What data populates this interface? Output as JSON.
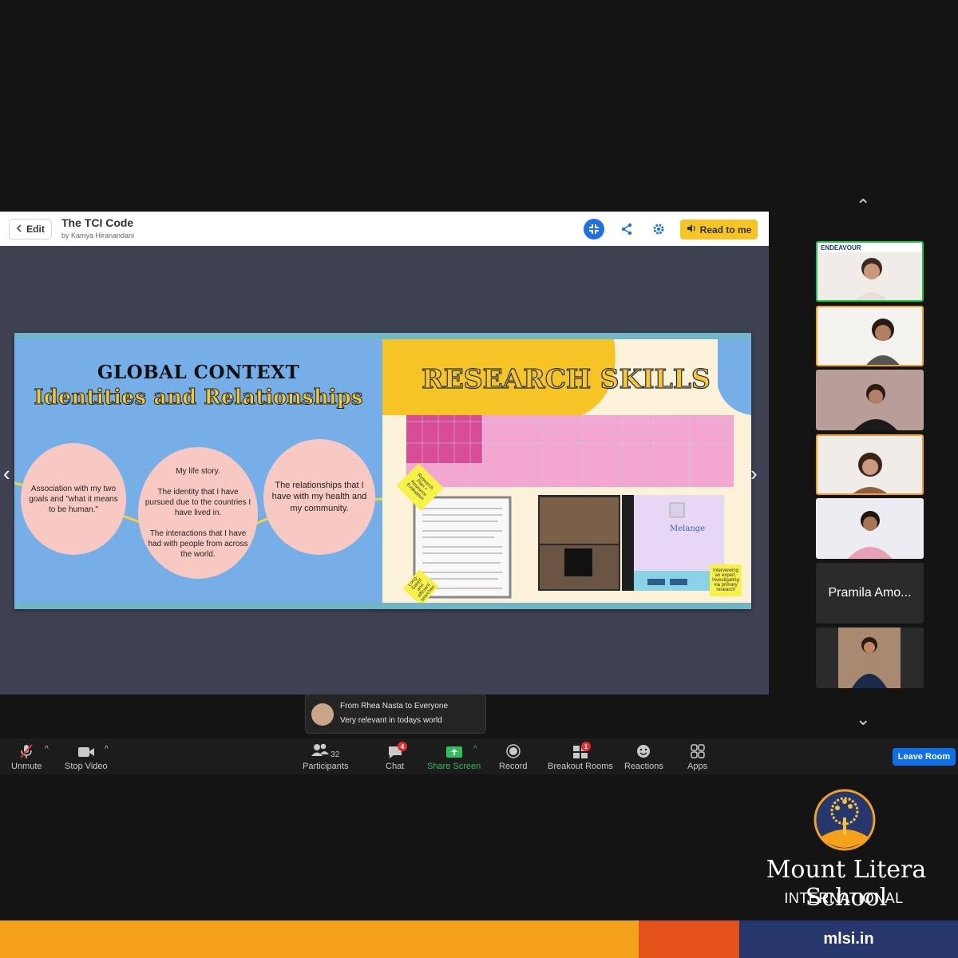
{
  "book": {
    "edit_label": "Edit",
    "title": "The TCI Code",
    "author": "by Kamya Hiranandani",
    "read_label": "Read to me"
  },
  "left_page": {
    "heading": "GLOBAL CONTEXT",
    "subheading": "Identities and Relationships",
    "bubbles": [
      "Association with my two goals and \"what it means to be human.\"",
      "My life story.\n\nThe identity that I have pursued due to the countries I have lived in.\n\nThe interactions that I have had with people from across the world.",
      "The relationships that I have with my health and my community."
    ]
  },
  "right_page": {
    "heading": "RESEARCH SKILLS",
    "sticky_notes": [
      "Research Plan + Resource Evaluation",
      "Long-Gated and efficient searches",
      "Interviewing an expert, Investigating via primary research"
    ],
    "site_title": "Melange"
  },
  "participants": {
    "name_tile": "Pramila Amo...",
    "endeavour_label": "ENDEAVOUR"
  },
  "chat": {
    "from": "From Rhea Nasta to Everyone",
    "message": "Very relevant in todays world"
  },
  "toolbar": {
    "unmute": "Unmute",
    "stop_video": "Stop Video",
    "participants_count": "32",
    "participants": "Participants",
    "chat": "Chat",
    "chat_badge": "4",
    "share_screen": "Share Screen",
    "record": "Record",
    "breakout_rooms": "Breakout Rooms",
    "breakout_badge": "1",
    "reactions": "Reactions",
    "apps": "Apps",
    "leave": "Leave Room"
  },
  "branding": {
    "school": "Mount Litera School",
    "sub": "INTERNATIONAL",
    "url": "mlsi.in"
  },
  "colors": {
    "toolbar_bg": "#1c1c1c",
    "leave_blue": "#0e71eb",
    "share_green": "#2dbf5a",
    "brand_orange": "#f4a11c",
    "brand_navy": "#25376c"
  }
}
